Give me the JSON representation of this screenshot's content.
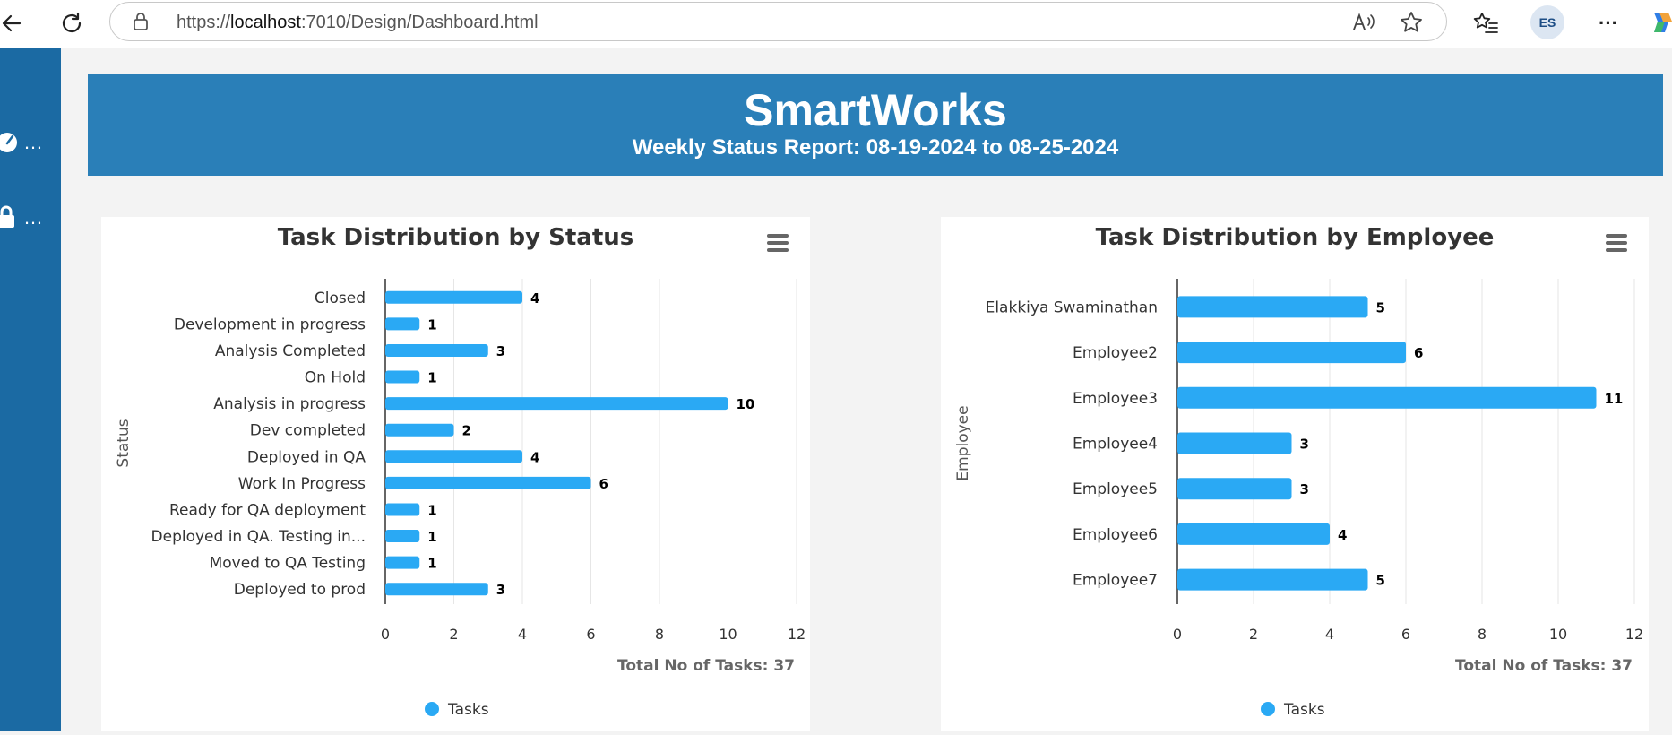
{
  "browser": {
    "url_prefix": "https://",
    "url_host": "localhost",
    "url_path": ":7010/Design/Dashboard.html",
    "profile_initials": "ES",
    "more_label": "···"
  },
  "sidebar": {
    "items": [
      {
        "icon": "dashboard-gauge-icon",
        "label": "…"
      },
      {
        "icon": "lock-icon",
        "label": "…"
      }
    ]
  },
  "header": {
    "title": "SmartWorks",
    "subtitle": "Weekly Status Report: 08-19-2024 to 08-25-2024"
  },
  "colors": {
    "banner": "#2a7fb8",
    "sidebar": "#1b6aa3",
    "bar": "#2aa9f4"
  },
  "chart_data": [
    {
      "type": "bar",
      "orientation": "horizontal",
      "title": "Task Distribution by Status",
      "ylabel": "Status",
      "xlim": [
        0,
        12
      ],
      "xticks": [
        0,
        2,
        4,
        6,
        8,
        10,
        12
      ],
      "categories": [
        "Closed",
        "Development in progress",
        "Analysis Completed",
        "On Hold",
        "Analysis in progress",
        "Dev completed",
        "Deployed in QA",
        "Work In Progress",
        "Ready for QA deployment",
        "Deployed in QA. Testing in...",
        "Moved to QA Testing",
        "Deployed to prod"
      ],
      "series": [
        {
          "name": "Tasks",
          "values": [
            4,
            1,
            3,
            1,
            10,
            2,
            4,
            6,
            1,
            1,
            1,
            3
          ]
        }
      ],
      "total_label": "Total No of Tasks: 37",
      "grid": true,
      "legend": "bottom-center"
    },
    {
      "type": "bar",
      "orientation": "horizontal",
      "title": "Task Distribution by Employee",
      "ylabel": "Employee",
      "xlim": [
        0,
        12
      ],
      "xticks": [
        0,
        2,
        4,
        6,
        8,
        10,
        12
      ],
      "categories": [
        "Elakkiya Swaminathan",
        "Employee2",
        "Employee3",
        "Employee4",
        "Employee5",
        "Employee6",
        "Employee7"
      ],
      "series": [
        {
          "name": "Tasks",
          "values": [
            5,
            6,
            11,
            3,
            3,
            4,
            5
          ]
        }
      ],
      "total_label": "Total No of Tasks: 37",
      "grid": true,
      "legend": "bottom-center"
    }
  ]
}
